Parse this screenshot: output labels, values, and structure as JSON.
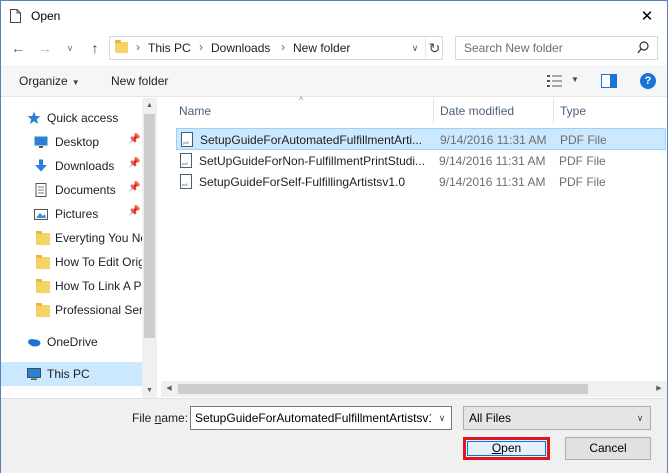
{
  "window": {
    "title": "Open"
  },
  "nav": {
    "breadcrumbs": [
      "This PC",
      "Downloads",
      "New folder"
    ],
    "search_placeholder": "Search New folder"
  },
  "toolbar": {
    "organize_label": "Organize",
    "new_folder_label": "New folder",
    "help_label": "?"
  },
  "sidebar": {
    "items": [
      {
        "label": "Quick access",
        "icon": "star-icon"
      },
      {
        "label": "Desktop",
        "icon": "desktop-icon",
        "pinned": true
      },
      {
        "label": "Downloads",
        "icon": "download-icon",
        "pinned": true
      },
      {
        "label": "Documents",
        "icon": "documents-icon",
        "pinned": true
      },
      {
        "label": "Pictures",
        "icon": "pictures-icon",
        "pinned": true
      },
      {
        "label": "Everyting You Ne",
        "icon": "folder-icon"
      },
      {
        "label": "How To Edit Origi",
        "icon": "folder-icon"
      },
      {
        "label": "How To Link A P",
        "icon": "folder-icon"
      },
      {
        "label": "Professional Serv",
        "icon": "folder-icon"
      },
      {
        "label": "OneDrive",
        "icon": "onedrive-icon"
      },
      {
        "label": "This PC",
        "icon": "computer-icon",
        "selected": true
      }
    ]
  },
  "files": {
    "columns": {
      "name": "Name",
      "date": "Date modified",
      "type": "Type"
    },
    "rows": [
      {
        "name": "SetupGuideForAutomatedFulfillmentArti...",
        "date": "9/14/2016 11:31 AM",
        "type": "PDF File",
        "selected": true
      },
      {
        "name": "SetUpGuideForNon-FulfillmentPrintStudi...",
        "date": "9/14/2016 11:31 AM",
        "type": "PDF File"
      },
      {
        "name": "SetupGuideForSelf-FulfillingArtistsv1.0",
        "date": "9/14/2016 11:31 AM",
        "type": "PDF File"
      }
    ]
  },
  "bottom": {
    "file_name_label_pre": "File ",
    "file_name_label_ul": "n",
    "file_name_label_post": "ame:",
    "file_name_value": "SetupGuideForAutomatedFulfillmentArtistsv1",
    "filter_value": "All Files",
    "open_label_ul": "O",
    "open_label_rest": "pen",
    "cancel_label": "Cancel"
  },
  "colors": {
    "selection": "#cce8ff",
    "accent": "#0078d7",
    "highlight_box": "#e3141e"
  }
}
